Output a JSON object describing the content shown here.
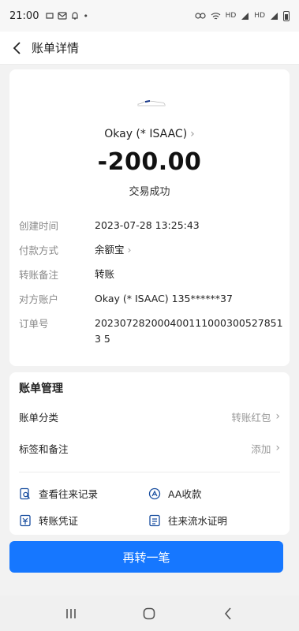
{
  "status_bar": {
    "time": "21:00",
    "left_icons": [
      "notification-icon",
      "mail-icon",
      "bell-icon",
      "dot"
    ],
    "right_icons": [
      "vpn-icon",
      "wifi-icon",
      "signal-icon",
      "battery-icon"
    ],
    "hd1": "HD",
    "hd2": "HD"
  },
  "header": {
    "title": "账单详情"
  },
  "transaction": {
    "merchant": "Okay (* ISAAC)",
    "amount": "-200.00",
    "status": "交易成功"
  },
  "details": [
    {
      "label": "创建时间",
      "value": "2023-07-28 13:25:43"
    },
    {
      "label": "付款方式",
      "value": "余额宝"
    },
    {
      "label": "转账备注",
      "value": "转账"
    },
    {
      "label": "对方账户",
      "value": "Okay (* ISAAC) 135******37"
    },
    {
      "label": "订单号",
      "value": "2023072820004001110003005278513 5"
    }
  ],
  "manage": {
    "title": "账单管理",
    "rows": [
      {
        "label": "账单分类",
        "value": "转账红包"
      },
      {
        "label": "标签和备注",
        "value": "添加"
      }
    ],
    "links": [
      {
        "label": "查看往来记录",
        "icon": "search-record-icon"
      },
      {
        "label": "AA收款",
        "icon": "aa-icon"
      },
      {
        "label": "转账凭证",
        "icon": "voucher-icon"
      },
      {
        "label": "往来流水证明",
        "icon": "statement-icon"
      }
    ]
  },
  "cta": {
    "label": "再转一笔"
  },
  "colors": {
    "accent": "#1677ff",
    "background": "#f2f2f2"
  }
}
